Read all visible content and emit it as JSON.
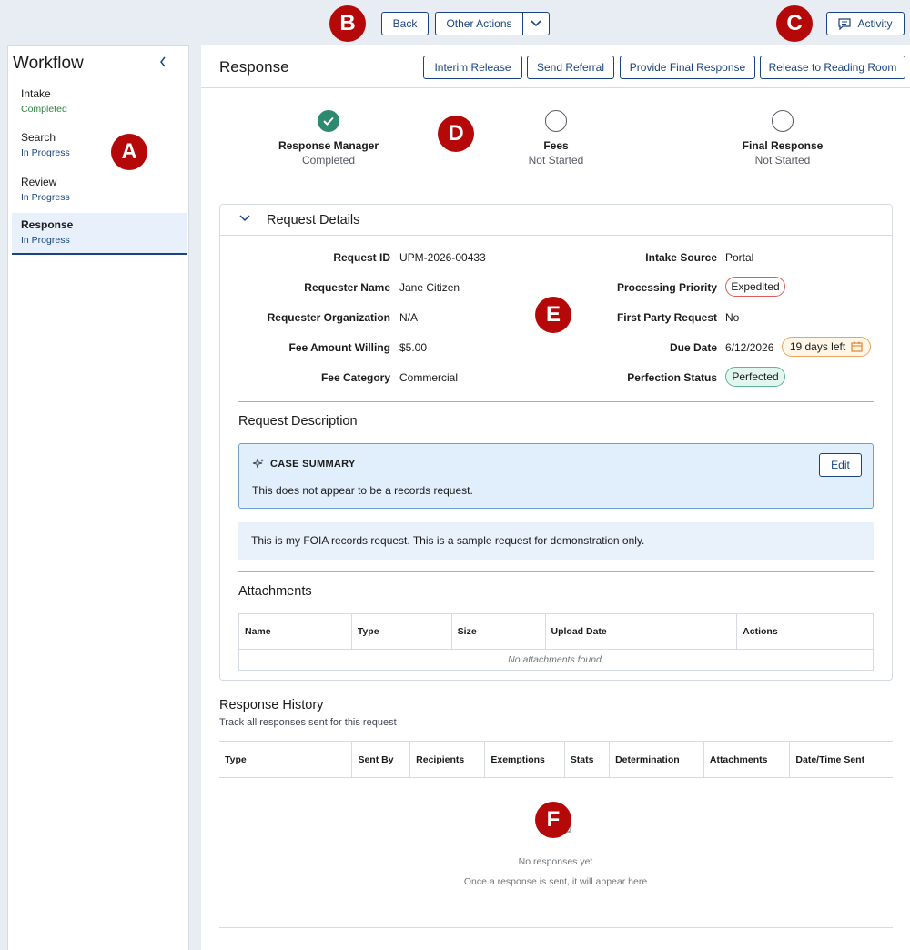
{
  "top_bar": {
    "back_label": "Back",
    "other_actions_label": "Other Actions",
    "activity_label": "Activity"
  },
  "markers": {
    "a": "A",
    "b": "B",
    "c": "C",
    "d": "D",
    "e": "E",
    "f": "F"
  },
  "sidebar": {
    "title": "Workflow",
    "items": [
      {
        "label": "Intake",
        "status": "Completed"
      },
      {
        "label": "Search",
        "status": "In Progress"
      },
      {
        "label": "Review",
        "status": "In Progress"
      },
      {
        "label": "Response",
        "status": "In Progress"
      }
    ]
  },
  "main": {
    "title": "Response",
    "actions": {
      "interim_release": "Interim Release",
      "send_referral": "Send Referral",
      "provide_final_response": "Provide Final Response",
      "release_to_reading_room": "Release to Reading Room"
    },
    "steps": [
      {
        "label": "Response Manager",
        "status": "Completed"
      },
      {
        "label": "Fees",
        "status": "Not Started"
      },
      {
        "label": "Final Response",
        "status": "Not Started"
      }
    ]
  },
  "request_details": {
    "title": "Request Details",
    "left": [
      {
        "label": "Request ID",
        "value": "UPM-2026-00433"
      },
      {
        "label": "Requester Name",
        "value": "Jane Citizen"
      },
      {
        "label": "Requester Organization",
        "value": "N/A"
      },
      {
        "label": "Fee Amount Willing",
        "value": "$5.00"
      },
      {
        "label": "Fee Category",
        "value": "Commercial"
      }
    ],
    "right": [
      {
        "label": "Intake Source",
        "value": "Portal"
      },
      {
        "label": "Processing Priority",
        "value": "Expedited"
      },
      {
        "label": "First Party Request",
        "value": "No"
      },
      {
        "label": "Due Date",
        "value": "6/12/2026",
        "badge": "19 days left"
      },
      {
        "label": "Perfection Status",
        "value": "Perfected"
      }
    ],
    "description_title": "Request Description",
    "case_summary": {
      "title": "CASE SUMMARY",
      "text": "This does not appear to be a records request.",
      "edit_label": "Edit"
    },
    "description_text": "This is my FOIA records request. This is a sample request for demonstration only.",
    "attachments_title": "Attachments",
    "attachments_columns": [
      "Name",
      "Type",
      "Size",
      "Upload Date",
      "Actions"
    ],
    "attachments_empty": "No attachments found."
  },
  "response_history": {
    "title": "Response History",
    "subtitle": "Track all responses sent for this request",
    "columns": [
      "Type",
      "Sent By",
      "Recipients",
      "Exemptions",
      "Stats",
      "Determination",
      "Attachments",
      "Date/Time Sent"
    ],
    "empty_title": "No responses yet",
    "empty_subtitle": "Once a response is sent, it will appear here"
  },
  "colors": {
    "primary": "#1a4480",
    "completed": "#2e8a6e",
    "marker": "#b50909"
  }
}
